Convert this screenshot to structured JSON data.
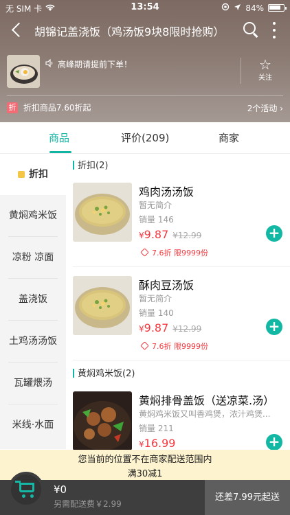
{
  "status_bar": {
    "carrier": "无 SIM 卡",
    "time": "13:54",
    "battery": "84%",
    "battery_level": 0.84
  },
  "header": {
    "title": "胡锦记盖浇饭（鸡汤饭9块8限时抢购）",
    "notice": "高峰期请提前下单！",
    "follow_label": "关注",
    "promo_badge": "折",
    "promo_text": "折扣商品7.60折起",
    "activities": "2个活动 ›"
  },
  "tabs": [
    {
      "label": "商品"
    },
    {
      "label": "评价(209)"
    },
    {
      "label": "商家"
    }
  ],
  "sidebar": {
    "items": [
      {
        "label": "折扣"
      },
      {
        "label": "黄焖鸡米饭"
      },
      {
        "label": "凉粉 凉面"
      },
      {
        "label": "盖浇饭"
      },
      {
        "label": "土鸡汤汤饭"
      },
      {
        "label": "瓦罐煨汤"
      },
      {
        "label": "米线·水面"
      }
    ]
  },
  "sections": [
    {
      "title": "折扣(2)",
      "goods": [
        {
          "name": "鸡肉汤汤饭",
          "desc": "暂无简介",
          "sales": "销量 146",
          "currency": "¥",
          "price": "9.87",
          "old_price": "¥12.99",
          "discount": "7.6折 限9999份"
        },
        {
          "name": "酥肉豆汤饭",
          "desc": "暂无简介",
          "sales": "销量 140",
          "currency": "¥",
          "price": "9.87",
          "old_price": "¥12.99",
          "discount": "7.6折 限9999份"
        }
      ]
    },
    {
      "title": "黄焖鸡米饭(2)",
      "goods": [
        {
          "name": "黄焖排骨盖饭（送凉菜.汤）",
          "desc": "黄焖鸡米饭又叫香鸡煲，浓汁鸡煲...",
          "sales": "销量 211",
          "currency": "¥",
          "price": "16.99"
        }
      ]
    }
  ],
  "bottom": {
    "out_of_range": "您当前的位置不在商家配送范围内",
    "promotion": "满30减1",
    "cart_total": "¥0",
    "delivery_fee": "另需配送费￥2.99",
    "checkout": "还差7.99元起送"
  },
  "colors": {
    "accent": "#12b5a3",
    "price": "#f3393f",
    "notice_bg": "#fdf3cf"
  }
}
